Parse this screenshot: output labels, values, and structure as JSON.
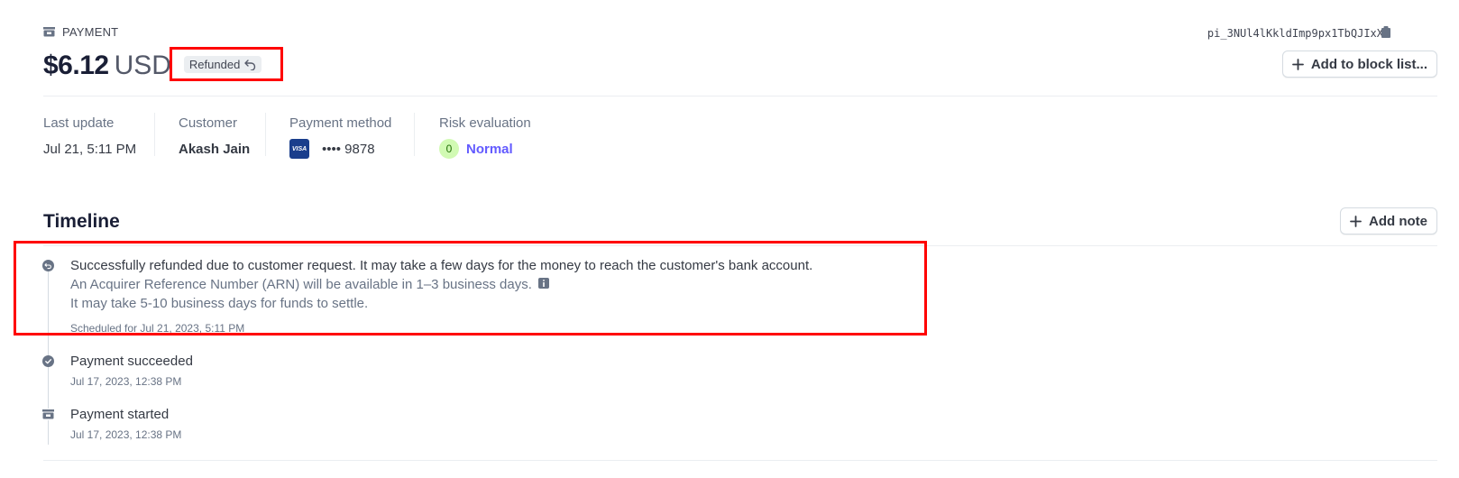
{
  "header": {
    "eyebrow": "PAYMENT",
    "payment_id": "pi_3NUl4lKkldImp9px1TbQJIxX",
    "amount": "$6.12",
    "currency": "USD",
    "status_badge": "Refunded",
    "block_button": "Add to block list..."
  },
  "details": {
    "last_update": {
      "label": "Last update",
      "value": "Jul 21, 5:11 PM"
    },
    "customer": {
      "label": "Customer",
      "value": "Akash Jain"
    },
    "payment_method": {
      "label": "Payment method",
      "brand": "VISA",
      "value": "•••• 9878"
    },
    "risk": {
      "label": "Risk evaluation",
      "score": "0",
      "value": "Normal"
    }
  },
  "timeline": {
    "title": "Timeline",
    "add_note_button": "Add note",
    "events": [
      {
        "text": "Successfully refunded due to customer request. It may take a few days for the money to reach the customer's bank account.",
        "sub1": "An Acquirer Reference Number (ARN) will be available in 1–3 business days.",
        "sub2": "It may take 5-10 business days for funds to settle.",
        "time": "Scheduled for Jul 21, 2023, 5:11 PM",
        "icon": "refund-icon"
      },
      {
        "text": "Payment succeeded",
        "time": "Jul 17, 2023, 12:38 PM",
        "icon": "check-circle-icon"
      },
      {
        "text": "Payment started",
        "time": "Jul 17, 2023, 12:38 PM",
        "icon": "payment-icon"
      }
    ]
  },
  "colors": {
    "accent": "#635bff",
    "highlight": "#ff0000",
    "risk_bg": "#d1fab3",
    "visa": "#1a3e8c"
  }
}
